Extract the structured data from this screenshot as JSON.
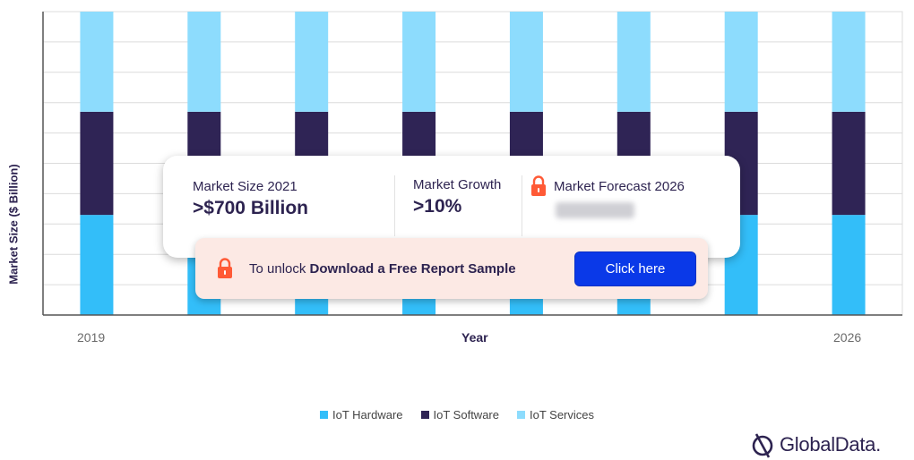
{
  "chart_data": {
    "type": "bar",
    "stacked": true,
    "title": "",
    "xlabel": "Year",
    "ylabel": "Market Size ($ Billion)",
    "categories": [
      "2019",
      "",
      "",
      "",
      "",
      "",
      "",
      "2026"
    ],
    "x_tick_labels": [
      "2019",
      "2026"
    ],
    "ylim": [
      0,
      100
    ],
    "grid": true,
    "legend_position": "bottom",
    "series": [
      {
        "name": "IoT Hardware",
        "color": "#33bef9",
        "values": [
          33,
          33,
          33,
          33,
          33,
          33,
          33,
          33
        ]
      },
      {
        "name": "IoT Software",
        "color": "#2f2455",
        "values": [
          34,
          34,
          34,
          34,
          34,
          34,
          34,
          34
        ]
      },
      {
        "name": "IoT Services",
        "color": "#8ddcfd",
        "values": [
          33,
          33,
          33,
          33,
          33,
          33,
          33,
          33
        ]
      }
    ]
  },
  "overlay": {
    "market_size_label": "Market Size 2021",
    "market_size_value": ">$700 Billion",
    "market_growth_label": "Market Growth",
    "market_growth_value": ">10%",
    "market_forecast_label": "Market Forecast 2026",
    "lock_icon": "lock-icon",
    "unlock_prefix": "To unlock",
    "unlock_bold": "Download a Free Report Sample",
    "cta_label": "Click here",
    "accent_color": "#ff5a36",
    "cta_color": "#0a39e8"
  },
  "brand": {
    "name": "GlobalData."
  }
}
